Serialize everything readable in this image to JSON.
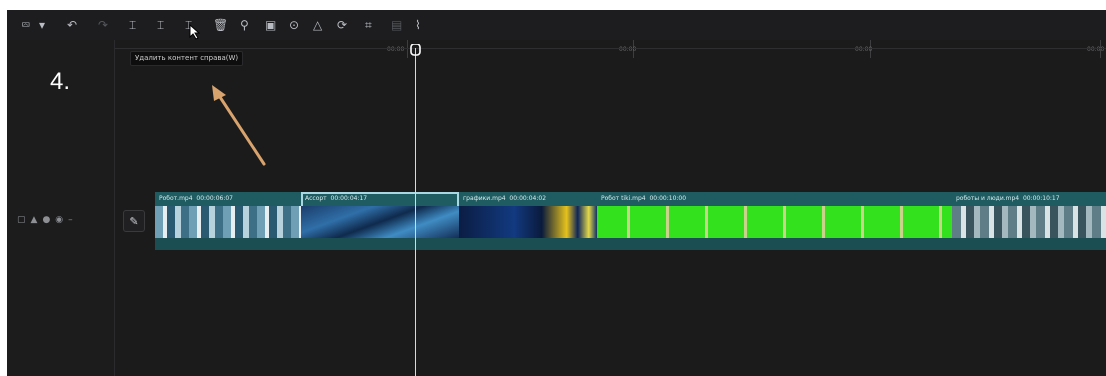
{
  "toolbar": {
    "tools": [
      {
        "name": "select-tool-icon",
        "glyph": "⮹"
      },
      {
        "name": "dropdown-chevron-icon",
        "glyph": "▾"
      },
      {
        "name": "undo-icon",
        "glyph": "↶"
      },
      {
        "name": "redo-icon",
        "glyph": "↷"
      },
      {
        "name": "split-icon",
        "glyph": "⌶"
      },
      {
        "name": "delete-left-icon",
        "glyph": "⌶"
      },
      {
        "name": "delete-right-icon",
        "glyph": "⌶"
      },
      {
        "name": "delete-icon",
        "glyph": "🗑"
      },
      {
        "name": "marker-icon",
        "glyph": "⚲"
      },
      {
        "name": "freeze-icon",
        "glyph": "▣"
      },
      {
        "name": "reverse-icon",
        "glyph": "⊙"
      },
      {
        "name": "mirror-icon",
        "glyph": "△"
      },
      {
        "name": "rotate-icon",
        "glyph": "⟳"
      },
      {
        "name": "crop-icon",
        "glyph": "⌗"
      },
      {
        "name": "disabled-tool-icon",
        "glyph": "▤"
      },
      {
        "name": "audio-split-icon",
        "glyph": "⌇"
      }
    ]
  },
  "tooltip": {
    "text": "Удалить контент справа(W)"
  },
  "annotation": {
    "step_number": "4."
  },
  "ruler": {
    "labels": [
      "00:00",
      "00:00",
      "00:00",
      "00:00"
    ]
  },
  "track": {
    "clips": [
      {
        "name": "Робот.mp4",
        "duration": "00:00:06:07"
      },
      {
        "name": "Ассорт",
        "duration": "00:00:04:17"
      },
      {
        "name": "графики.mp4",
        "duration": "00:00:04:02"
      },
      {
        "name": "Робот tiki.mp4",
        "duration": "00:00:10:00"
      },
      {
        "name": "роботы и люди.mp4",
        "duration": "00:00:10:17"
      }
    ]
  },
  "colors": {
    "clip_background": "#1f5c61",
    "selection_outline": "#a9d7e2",
    "green_screen": "#33e21d",
    "arrow": "#d8a36c"
  }
}
